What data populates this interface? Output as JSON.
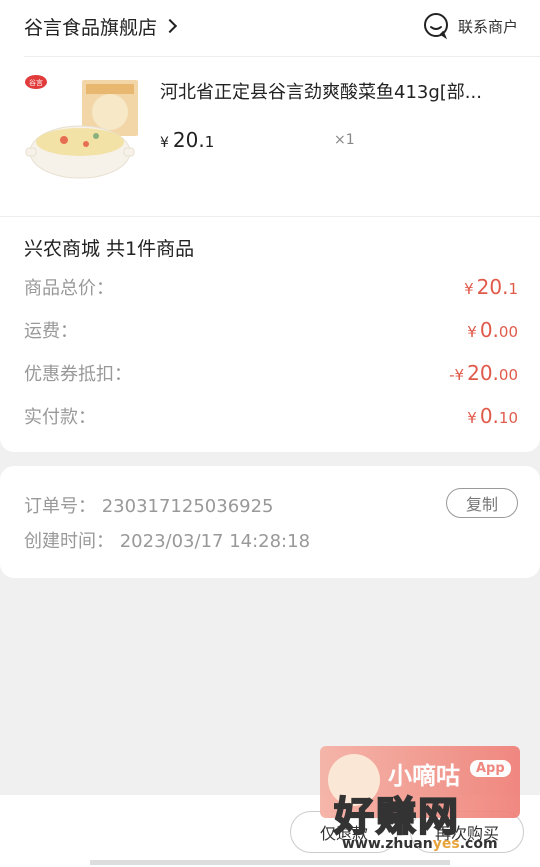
{
  "store": {
    "name": "谷言食品旗舰店",
    "contact_label": "联系商户"
  },
  "product": {
    "title": "河北省正定县谷言劲爽酸菜鱼413g[部...",
    "currency": "¥",
    "price_int": "20.",
    "price_dec": "1",
    "qty": "×1",
    "brand_badge": "谷言"
  },
  "summary": {
    "title": "兴农商城 共1件商品",
    "rows": [
      {
        "label": "商品总价：",
        "cur": "¥",
        "int": "20.",
        "dec": "1"
      },
      {
        "label": "运费：",
        "cur": "¥",
        "int": "0.",
        "dec": "00"
      },
      {
        "label": "优惠券抵扣：",
        "cur": "-¥",
        "int": "20.",
        "dec": "00"
      },
      {
        "label": "实付款：",
        "cur": "¥",
        "int": "0.",
        "dec": "10"
      }
    ]
  },
  "order": {
    "number_line": "订单号：  230317125036925",
    "created_line": "创建时间：  2023/03/17 14:28:18",
    "copy_label": "复制"
  },
  "bottom": {
    "refund_label": "仅退款",
    "rebuy_label": "再次购买"
  },
  "watermark": {
    "app_name": "小嘀咕",
    "app_badge": "App",
    "big_text": "好赚网",
    "url_pre": "www.zhuan",
    "url_hl": "yes",
    "url_post": ".com"
  },
  "colors": {
    "price_red": "#e05a4a",
    "muted": "#999999"
  }
}
